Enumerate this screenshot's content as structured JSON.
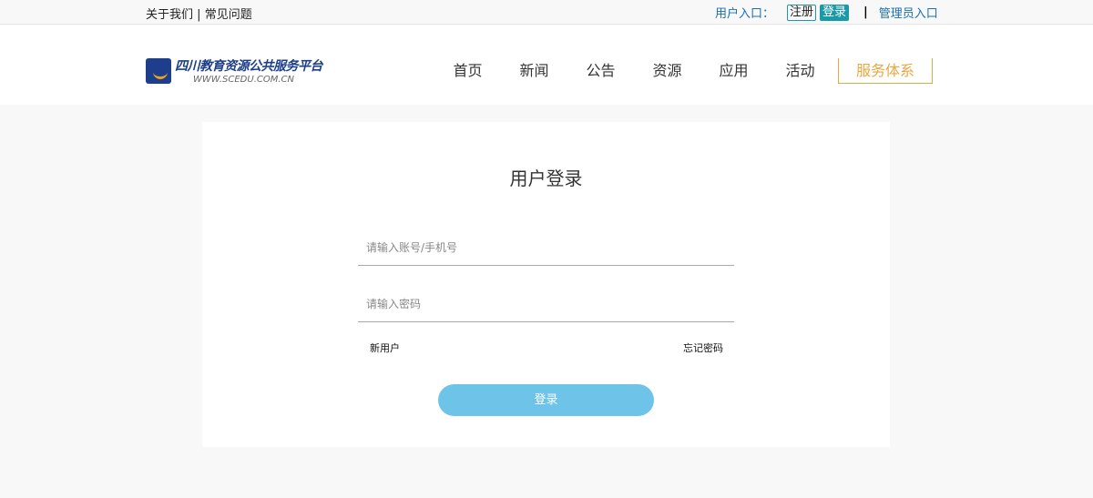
{
  "topbar": {
    "about": "关于我们",
    "divider": "|",
    "faq": "常见问题",
    "user_entry": "用户入口：",
    "register": "注册",
    "login": "登录",
    "separator": "|",
    "admin_entry": "管理员入口"
  },
  "logo": {
    "name": "四川教育资源公共服务平台",
    "url_text": "WWW.SCEDU.COM.CN"
  },
  "nav": [
    "首页",
    "新闻",
    "公告",
    "资源",
    "应用",
    "活动",
    "服务体系"
  ],
  "login": {
    "title": "用户登录",
    "account_placeholder": "请输入账号/手机号",
    "password_placeholder": "请输入密码",
    "new_user": "新用户",
    "forgot": "忘记密码",
    "submit": "登录"
  },
  "colors": {
    "accent": "#1a9aa6",
    "nav_highlight": "#e8a840",
    "button": "#6ec3e8"
  }
}
